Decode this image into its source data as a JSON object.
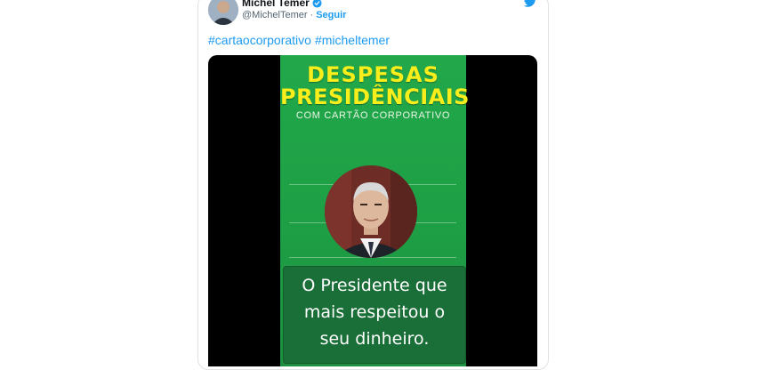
{
  "tweet": {
    "author_name": "Michel Temer",
    "handle": "@MichelTemer",
    "separator": "·",
    "follow_label": "Seguir",
    "hashtags": [
      "#cartaocorporativo",
      "#micheltemer"
    ]
  },
  "media": {
    "title_line1": "DESPESAS",
    "title_line2": "PRESIDÊNCIAIS",
    "subtitle": "COM CARTÃO CORPORATIVO",
    "caption_lines": [
      "O Presidente  que",
      "mais respeitou  o",
      "seu dinheiro."
    ]
  },
  "icons": {
    "verified": "verified-badge-icon",
    "brand": "twitter-bird-icon"
  },
  "colors": {
    "link": "#1d9bf0",
    "media_green": "#22a84b",
    "title_yellow": "#f7ee1b"
  }
}
